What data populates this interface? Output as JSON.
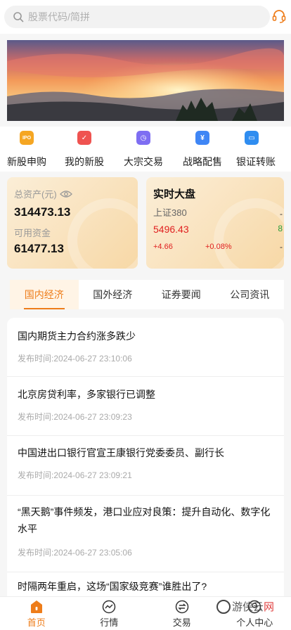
{
  "search": {
    "placeholder": "股票代码/简拼"
  },
  "quick_menu": [
    {
      "label": "新股申购",
      "icon": "ipo-icon",
      "color": "#f5a623",
      "glyph": "IPO"
    },
    {
      "label": "我的新股",
      "icon": "my-stocks-icon",
      "color": "#ef5350",
      "glyph": "✓"
    },
    {
      "label": "大宗交易",
      "icon": "block-trade-icon",
      "color": "#7e6ef2",
      "glyph": "◷"
    },
    {
      "label": "战略配售",
      "icon": "placement-icon",
      "color": "#3f86f5",
      "glyph": "¥"
    },
    {
      "label": "银证转账",
      "icon": "transfer-icon",
      "color": "#2f8df0",
      "glyph": "▭"
    }
  ],
  "assets": {
    "total_label": "总资产(元)",
    "total_value": "314473.13",
    "available_label": "可用资金",
    "available_value": "61477.13"
  },
  "market": {
    "title": "实时大盘",
    "index_name": "上证380",
    "price": "5496.43",
    "change": "+4.66",
    "change_pct": "+0.08%",
    "edge_1": "-",
    "edge_2": "8",
    "edge_3": "-"
  },
  "tabs": [
    {
      "label": "国内经济",
      "active": true
    },
    {
      "label": "国外经济",
      "active": false
    },
    {
      "label": "证券要闻",
      "active": false
    },
    {
      "label": "公司资讯",
      "active": false
    }
  ],
  "news": [
    {
      "title": "国内期货主力合约涨多跌少",
      "time_prefix": "发布时间:",
      "time": "2024-06-27 23:10:06"
    },
    {
      "title": "北京房贷利率，多家银行已调整",
      "time_prefix": "发布时间:",
      "time": "2024-06-27 23:09:23"
    },
    {
      "title": "中国进出口银行官宣王康银行党委委员、副行长",
      "time_prefix": "发布时间:",
      "time": "2024-06-27 23:09:21"
    },
    {
      "title": "“黑天鹅”事件频发，港口业应对良策：提升自动化、数字化水平",
      "time_prefix": "发布时间:",
      "time": "2024-06-27 23:05:06"
    },
    {
      "title": "时隔两年重启，这场“国家级竞赛”谁胜出了?",
      "time_prefix": "",
      "time": ""
    }
  ],
  "bottom_nav": [
    {
      "label": "首页",
      "icon": "home-icon",
      "active": true
    },
    {
      "label": "行情",
      "icon": "market-icon",
      "active": false
    },
    {
      "label": "交易",
      "icon": "trade-icon",
      "active": false
    },
    {
      "label": "个人中心",
      "icon": "profile-icon",
      "active": false
    }
  ],
  "watermark": {
    "text": "游侠云",
    "suffix": "网"
  },
  "colors": {
    "accent": "#ee7d1a",
    "up": "#e02020",
    "down": "#2a9d3a"
  }
}
